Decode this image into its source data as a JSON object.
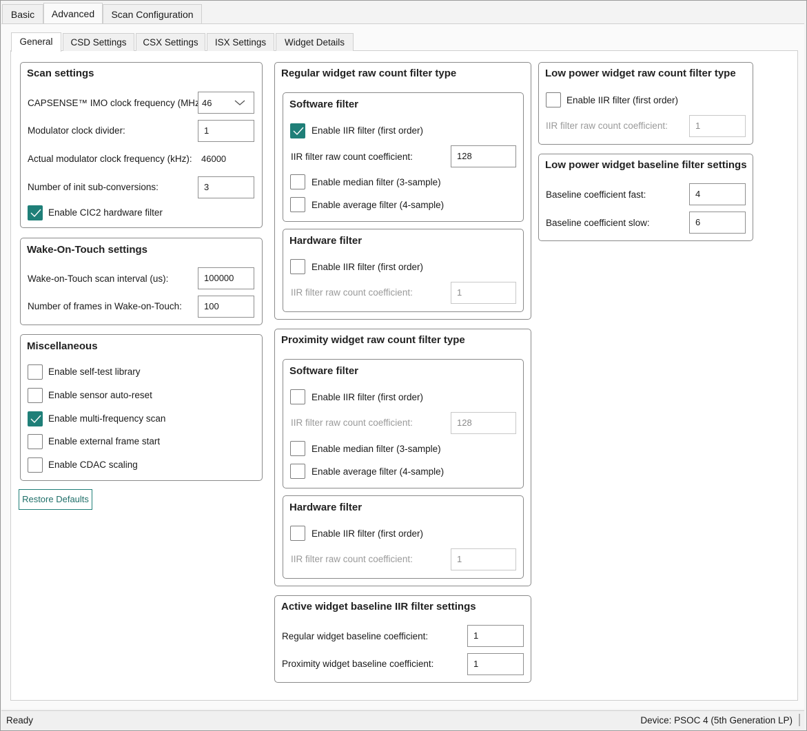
{
  "top_tabs": [
    "Basic",
    "Advanced",
    "Scan Configuration"
  ],
  "sub_tabs": [
    "General",
    "CSD Settings",
    "CSX Settings",
    "ISX Settings",
    "Widget Details"
  ],
  "scan_settings": {
    "title": "Scan settings",
    "imo_label": "CAPSENSE™ IMO clock frequency (MHz):",
    "imo_value": "46",
    "mod_div_label": "Modulator clock divider:",
    "mod_div_value": "1",
    "actual_mod_label": "Actual modulator clock frequency (kHz):",
    "actual_mod_value": "46000",
    "init_sub_label": "Number of init sub-conversions:",
    "init_sub_value": "3",
    "cic2_label": "Enable CIC2 hardware filter",
    "cic2_checked": true
  },
  "wot": {
    "title": "Wake-On-Touch settings",
    "interval_label": "Wake-on-Touch scan interval (us):",
    "interval_value": "100000",
    "frames_label": "Number of frames in Wake-on-Touch:",
    "frames_value": "100"
  },
  "misc": {
    "title": "Miscellaneous",
    "items": [
      {
        "label": "Enable self-test library",
        "checked": false
      },
      {
        "label": "Enable sensor auto-reset",
        "checked": false
      },
      {
        "label": "Enable multi-frequency scan",
        "checked": true
      },
      {
        "label": "Enable external frame start",
        "checked": false
      },
      {
        "label": "Enable CDAC scaling",
        "checked": false
      }
    ]
  },
  "restore_label": "Restore Defaults",
  "regular": {
    "title": "Regular widget raw count filter type",
    "sw_title": "Software filter",
    "sw_iir_label": "Enable IIR filter (first order)",
    "sw_iir_checked": true,
    "sw_coef_label": "IIR filter raw count coefficient:",
    "sw_coef_value": "128",
    "median_label": "Enable median filter (3-sample)",
    "average_label": "Enable average filter (4-sample)",
    "hw_title": "Hardware filter",
    "hw_iir_label": "Enable IIR filter (first order)",
    "hw_coef_label": "IIR filter raw count coefficient:",
    "hw_coef_value": "1"
  },
  "proximity": {
    "title": "Proximity widget raw count filter type",
    "sw_title": "Software filter",
    "sw_iir_label": "Enable IIR filter (first order)",
    "sw_coef_label": "IIR filter raw count coefficient:",
    "sw_coef_value": "128",
    "median_label": "Enable median filter (3-sample)",
    "average_label": "Enable average filter (4-sample)",
    "hw_title": "Hardware filter",
    "hw_iir_label": "Enable IIR filter (first order)",
    "hw_coef_label": "IIR filter raw count coefficient:",
    "hw_coef_value": "1"
  },
  "active_baseline": {
    "title": "Active widget baseline IIR filter settings",
    "regular_label": "Regular widget baseline coefficient:",
    "regular_value": "1",
    "proximity_label": "Proximity widget baseline coefficient:",
    "proximity_value": "1"
  },
  "lp_raw": {
    "title": "Low power widget raw count filter type",
    "iir_label": "Enable IIR filter (first order)",
    "coef_label": "IIR filter raw count coefficient:",
    "coef_value": "1"
  },
  "lp_baseline": {
    "title": "Low power widget baseline filter settings",
    "fast_label": "Baseline coefficient fast:",
    "fast_value": "4",
    "slow_label": "Baseline coefficient slow:",
    "slow_value": "6"
  },
  "status": {
    "left": "Ready",
    "right": "Device: PSOC 4 (5th Generation LP)"
  },
  "colors": {
    "accent": "#1f7f78"
  }
}
